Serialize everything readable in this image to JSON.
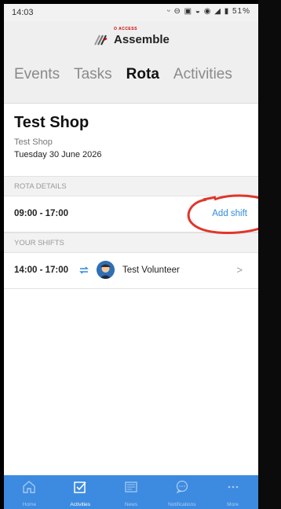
{
  "status_bar": {
    "time": "14:03",
    "battery": "51%",
    "icons": "ᵕ ⊖ ▣ ◒ ◉ ◢ ▮"
  },
  "brand": {
    "small": "O ACCESS",
    "name": "Assemble"
  },
  "tabs": [
    {
      "label": "Events",
      "active": false
    },
    {
      "label": "Tasks",
      "active": false
    },
    {
      "label": "Rota",
      "active": true
    },
    {
      "label": "Activities",
      "active": false
    }
  ],
  "shop": {
    "title": "Test Shop",
    "subtitle": "Test Shop",
    "date": "Tuesday 30 June 2026"
  },
  "rota_details": {
    "header": "ROTA DETAILS",
    "time": "09:00 - 17:00",
    "add_shift_label": "Add shift"
  },
  "your_shifts": {
    "header": "YOUR SHIFTS",
    "items": [
      {
        "time": "14:00 - 17:00",
        "volunteer": "Test Volunteer",
        "chevron": ">"
      }
    ]
  },
  "bottom_nav": [
    {
      "label": "Home",
      "icon": "home-icon"
    },
    {
      "label": "Activities",
      "icon": "checkbox-icon"
    },
    {
      "label": "News",
      "icon": "news-icon"
    },
    {
      "label": "Notifications",
      "icon": "chat-bubble-icon"
    },
    {
      "label": "More",
      "icon": "more-dots-icon"
    }
  ],
  "colors": {
    "accent": "#3d8be0",
    "link": "#2f8be0",
    "annotation": "#e0362c"
  }
}
